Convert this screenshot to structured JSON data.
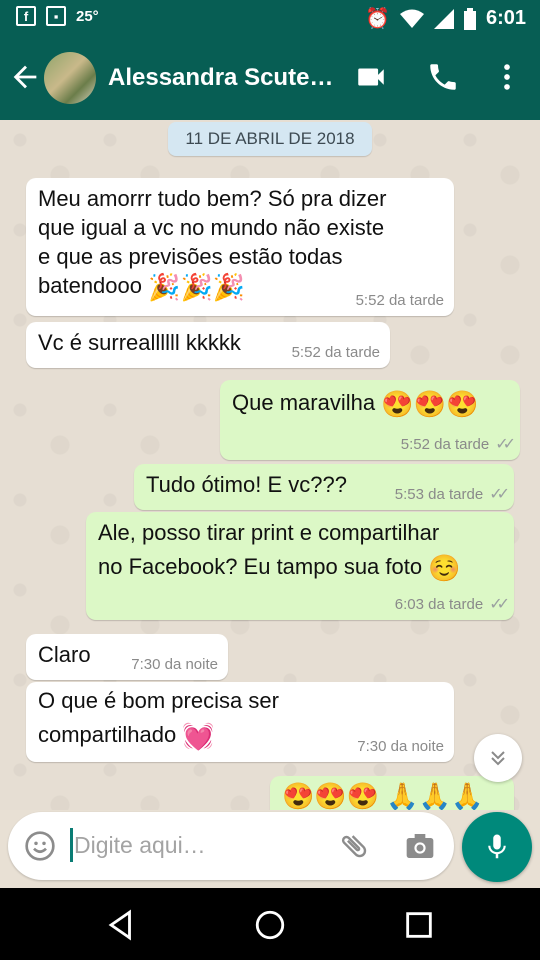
{
  "statusbar": {
    "temperature": "25°",
    "time": "6:01"
  },
  "appbar": {
    "contact_name": "Alessandra Scute…"
  },
  "chat": {
    "date_chip": "11 DE ABRIL DE 2018",
    "messages": [
      {
        "dir": "in",
        "lines": [
          "Meu amorrr tudo bem? Só pra dizer",
          "que igual a vc no mundo não existe",
          "e que as previsões estão todas",
          "batendooo"
        ],
        "emoji": "🎉🎉🎉",
        "time": "5:52 da tarde"
      },
      {
        "dir": "in",
        "text": "Vc é surreallllll kkkkk",
        "time": "5:52 da tarde"
      },
      {
        "dir": "out",
        "text": "Que maravilha",
        "emoji": "😍😍😍",
        "time": "5:52 da tarde"
      },
      {
        "dir": "out",
        "text": "Tudo ótimo! E vc???",
        "time": "5:53 da tarde"
      },
      {
        "dir": "out",
        "lines": [
          "Ale, posso tirar print e compartilhar",
          "no Facebook? Eu tampo sua foto"
        ],
        "emoji": "☺️",
        "time": "6:03 da tarde"
      },
      {
        "dir": "in",
        "text": "Claro",
        "time": "7:30 da noite"
      },
      {
        "dir": "in",
        "lines": [
          "O que é bom precisa ser",
          "compartilhado"
        ],
        "emoji": "💓",
        "time": "7:30 da noite"
      },
      {
        "dir": "out",
        "emoji": "😍😍😍 🙏🙏🙏"
      }
    ]
  },
  "input": {
    "placeholder": "Digite aqui…"
  },
  "icons": {
    "back": "arrow-left-icon",
    "video": "videocam-icon",
    "call": "phone-icon",
    "menu": "more-vert-icon",
    "emoji": "emoji-smile-icon",
    "attach": "paperclip-icon",
    "camera": "camera-icon",
    "mic": "mic-icon",
    "scroll": "double-chevron-down-icon"
  },
  "colors": {
    "header": "#075e54",
    "outgoing_bubble": "#dcf8c6",
    "incoming_bubble": "#ffffff",
    "fab": "#00897b"
  }
}
